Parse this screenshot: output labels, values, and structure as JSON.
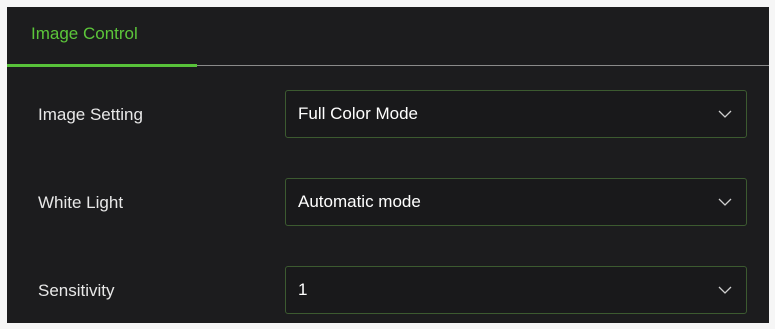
{
  "tabs": [
    {
      "label": "Image Control",
      "active": true
    }
  ],
  "settings": [
    {
      "label": "Image Setting",
      "value": "Full Color Mode"
    },
    {
      "label": "White Light",
      "value": "Automatic mode"
    },
    {
      "label": "Sensitivity",
      "value": "1"
    }
  ],
  "icons": {
    "dropdown": "chevron-down-icon"
  },
  "colors": {
    "accent": "#5cc63a",
    "panel_background": "#1c1c1e",
    "select_border": "#3c5a30",
    "text": "#e8e8e8"
  }
}
